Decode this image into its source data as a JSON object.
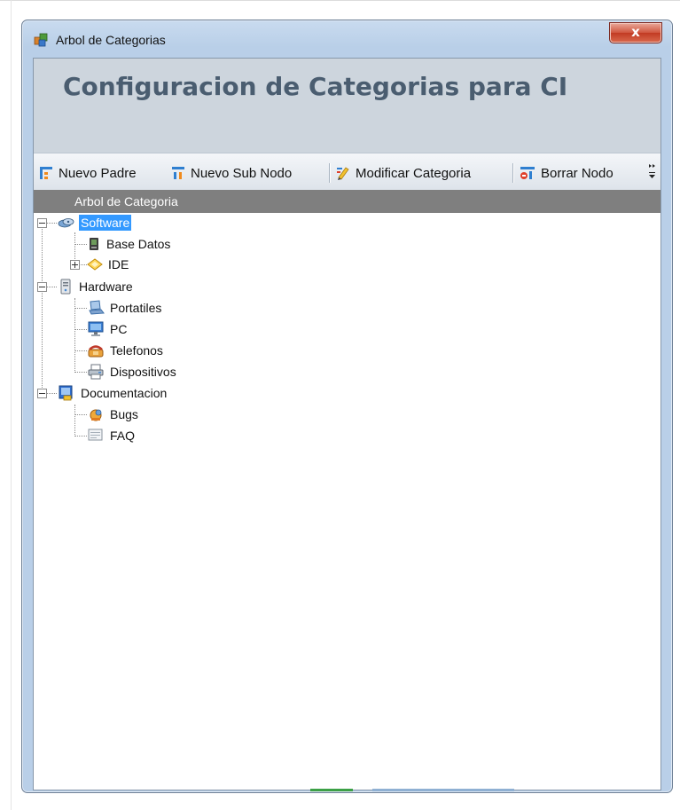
{
  "window": {
    "title": "Arbol de Categorias",
    "close_label": "x"
  },
  "header": {
    "title": "Configuracion de Categorias para CI"
  },
  "toolbar": {
    "buttons": [
      {
        "label": "Nuevo Padre",
        "icon": "new-parent-icon"
      },
      {
        "label": "Nuevo Sub Nodo",
        "icon": "new-subnode-icon"
      },
      {
        "label": "Modificar Categoria",
        "icon": "edit-icon"
      },
      {
        "label": "Borrar Nodo",
        "icon": "delete-node-icon"
      }
    ],
    "overflow_icon": "toolbar-overflow-icon"
  },
  "tree": {
    "header": "Arbol de Categoria",
    "nodes": [
      {
        "label": "Software",
        "icon": "software-icon",
        "level": 0,
        "expanded": true,
        "selected": true
      },
      {
        "label": "Base Datos",
        "icon": "database-icon",
        "level": 1
      },
      {
        "label": "IDE",
        "icon": "ide-icon",
        "level": 1,
        "expanded": false
      },
      {
        "label": "Hardware",
        "icon": "hardware-icon",
        "level": 0,
        "expanded": true
      },
      {
        "label": "Portatiles",
        "icon": "laptop-icon",
        "level": 1
      },
      {
        "label": "PC",
        "icon": "monitor-icon",
        "level": 1
      },
      {
        "label": "Telefonos",
        "icon": "phone-icon",
        "level": 1
      },
      {
        "label": "Dispositivos",
        "icon": "printer-icon",
        "level": 1
      },
      {
        "label": "Documentacion",
        "icon": "documentation-icon",
        "level": 0,
        "expanded": true
      },
      {
        "label": "Bugs",
        "icon": "bugs-icon",
        "level": 1
      },
      {
        "label": "FAQ",
        "icon": "faq-icon",
        "level": 1
      }
    ]
  },
  "colors": {
    "selection": "#3399ff",
    "header_band": "#cdd5dd",
    "header_text": "#4a5d70",
    "tree_header": "#7f7f7f"
  }
}
